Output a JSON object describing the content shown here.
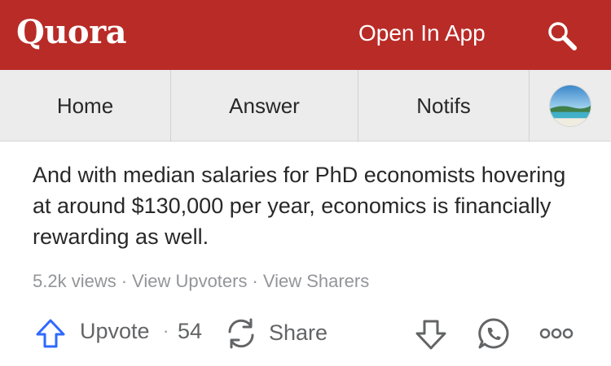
{
  "header": {
    "logo_text": "Quora",
    "open_in_app_label": "Open In App",
    "search_icon": "search-icon",
    "background_color": "#b92b27"
  },
  "nav": {
    "tabs": [
      {
        "label": "Home"
      },
      {
        "label": "Answer"
      },
      {
        "label": "Notifs"
      }
    ],
    "avatar_icon": "avatar"
  },
  "answer": {
    "text": "And with median salaries for PhD economists hovering at around $130,000 per year, economics is financially rewarding as well.",
    "views": "5.2k views",
    "separator": "·",
    "view_upvoters_label": "View Upvoters",
    "view_sharers_label": "View Sharers"
  },
  "actions": {
    "upvote_label": "Upvote",
    "upvote_separator": "·",
    "upvote_count": "54",
    "share_label": "Share",
    "icons": [
      "upvote-icon",
      "share-icon",
      "downvote-icon",
      "whatsapp-icon",
      "more-icon"
    ],
    "accent_color": "#2e69ff"
  }
}
